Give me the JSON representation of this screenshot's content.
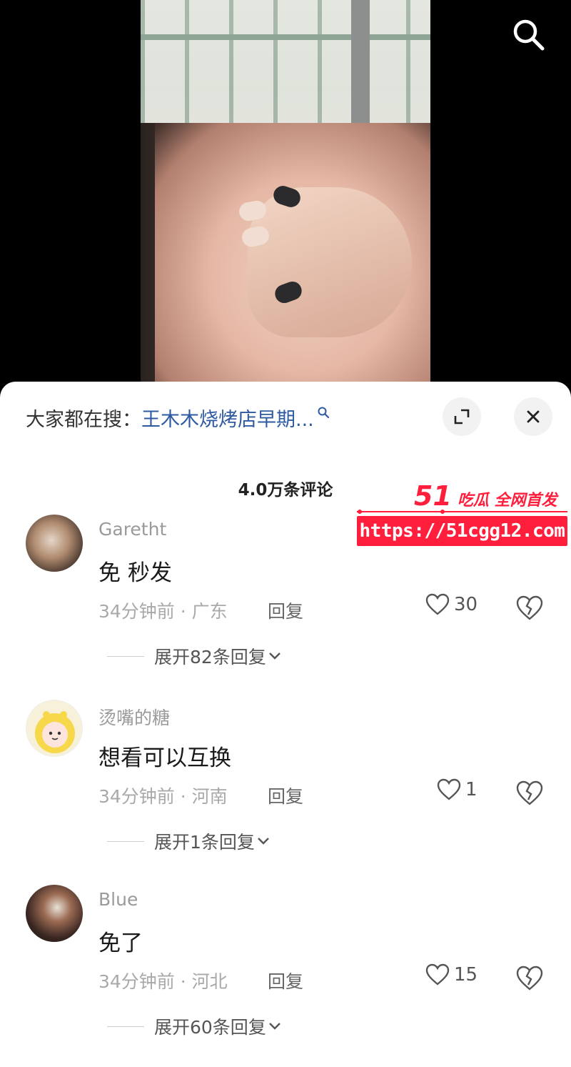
{
  "video": {
    "description_icon": "search-icon"
  },
  "watermark": {
    "brand_number": "51",
    "brand_tag": "吃瓜 全网首发",
    "url": "https://51cgg12.com"
  },
  "sheet": {
    "search_prefix": "大家都在搜：",
    "search_query": "王木木烧烤店早期...",
    "comment_count": "4.0万条评论"
  },
  "comments": [
    {
      "username": "Garetht",
      "content": "免 秒发",
      "meta": "34分钟前 · 广东",
      "reply_label": "回复",
      "likes": "30",
      "expand_label": "展开82条回复"
    },
    {
      "username": "烫嘴的糖",
      "content": "想看可以互换",
      "meta": "34分钟前 · 河南",
      "reply_label": "回复",
      "likes": "1",
      "expand_label": "展开1条回复"
    },
    {
      "username": "Blue",
      "content": "免了",
      "meta": "34分钟前 · 河北",
      "reply_label": "回复",
      "likes": "15",
      "expand_label": "展开60条回复"
    }
  ],
  "colors": {
    "link": "#2d5aa0",
    "watermark": "#ff1f3d"
  }
}
